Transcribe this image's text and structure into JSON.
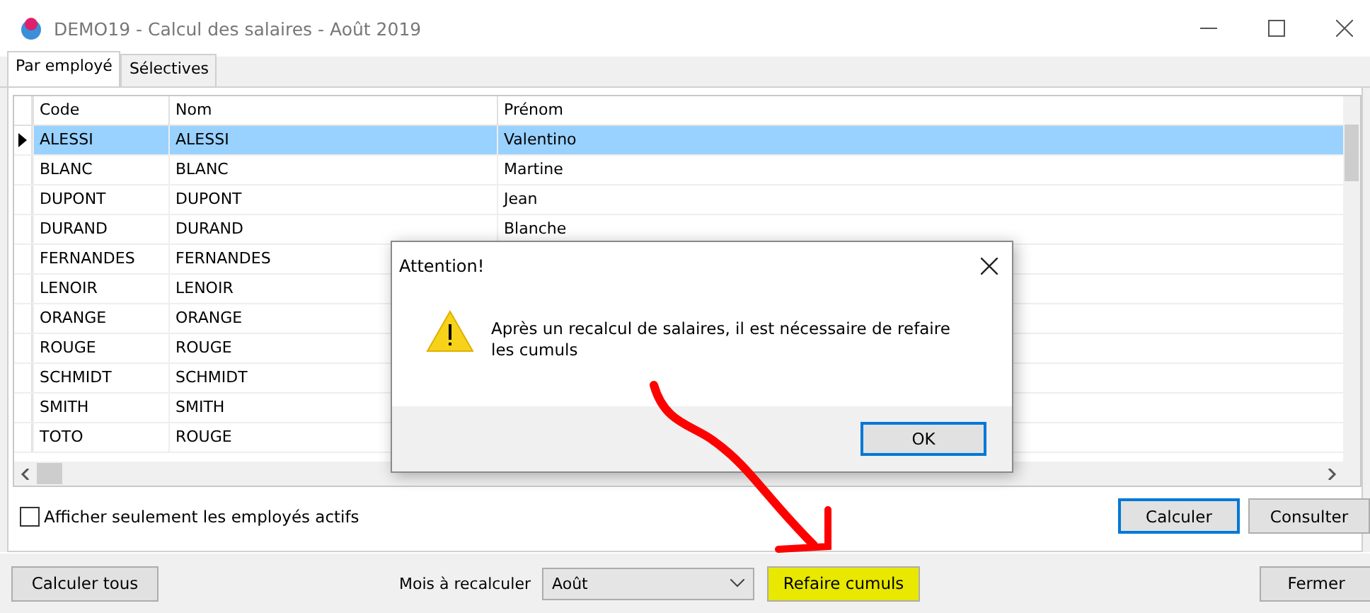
{
  "window": {
    "title": "DEMO19 - Calcul des salaires - Août 2019"
  },
  "tabs": [
    {
      "label": "Par employé",
      "selected": true
    },
    {
      "label": "Sélectives",
      "selected": false
    }
  ],
  "table": {
    "columns": [
      "Code",
      "Nom",
      "Prénom"
    ],
    "rows": [
      {
        "code": "ALESSI",
        "nom": "ALESSI",
        "prenom": "Valentino",
        "selected": true
      },
      {
        "code": "BLANC",
        "nom": "BLANC",
        "prenom": "Martine",
        "selected": false
      },
      {
        "code": "DUPONT",
        "nom": "DUPONT",
        "prenom": "Jean",
        "selected": false
      },
      {
        "code": "DURAND",
        "nom": "DURAND",
        "prenom": "Blanche",
        "selected": false
      },
      {
        "code": "FERNANDES",
        "nom": "FERNANDES",
        "selected": false
      },
      {
        "code": "LENOIR",
        "nom": "LENOIR",
        "selected": false
      },
      {
        "code": "ORANGE",
        "nom": "ORANGE",
        "selected": false
      },
      {
        "code": "ROUGE",
        "nom": "ROUGE",
        "selected": false
      },
      {
        "code": "SCHMIDT",
        "nom": "SCHMIDT",
        "selected": false
      },
      {
        "code": "SMITH",
        "nom": "SMITH",
        "selected": false
      },
      {
        "code": "TOTO",
        "nom": "ROUGE",
        "selected": false
      }
    ]
  },
  "filter": {
    "label": "Afficher seulement les employés actifs",
    "checked": false
  },
  "panel_buttons": [
    {
      "label": "Calculer",
      "default": true
    },
    {
      "label": "Consulter",
      "default": false
    }
  ],
  "bottom": {
    "calc_all": "Calculer tous",
    "month_label": "Mois à recalculer",
    "month_value": "Août",
    "redo_button": {
      "label": "Refaire cumuls",
      "highlighted": true
    },
    "close": "Fermer"
  },
  "dialog": {
    "title": "Attention!",
    "message": "Après un recalcul de salaires, il est nécessaire de refaire les cumuls",
    "ok": "OK"
  }
}
